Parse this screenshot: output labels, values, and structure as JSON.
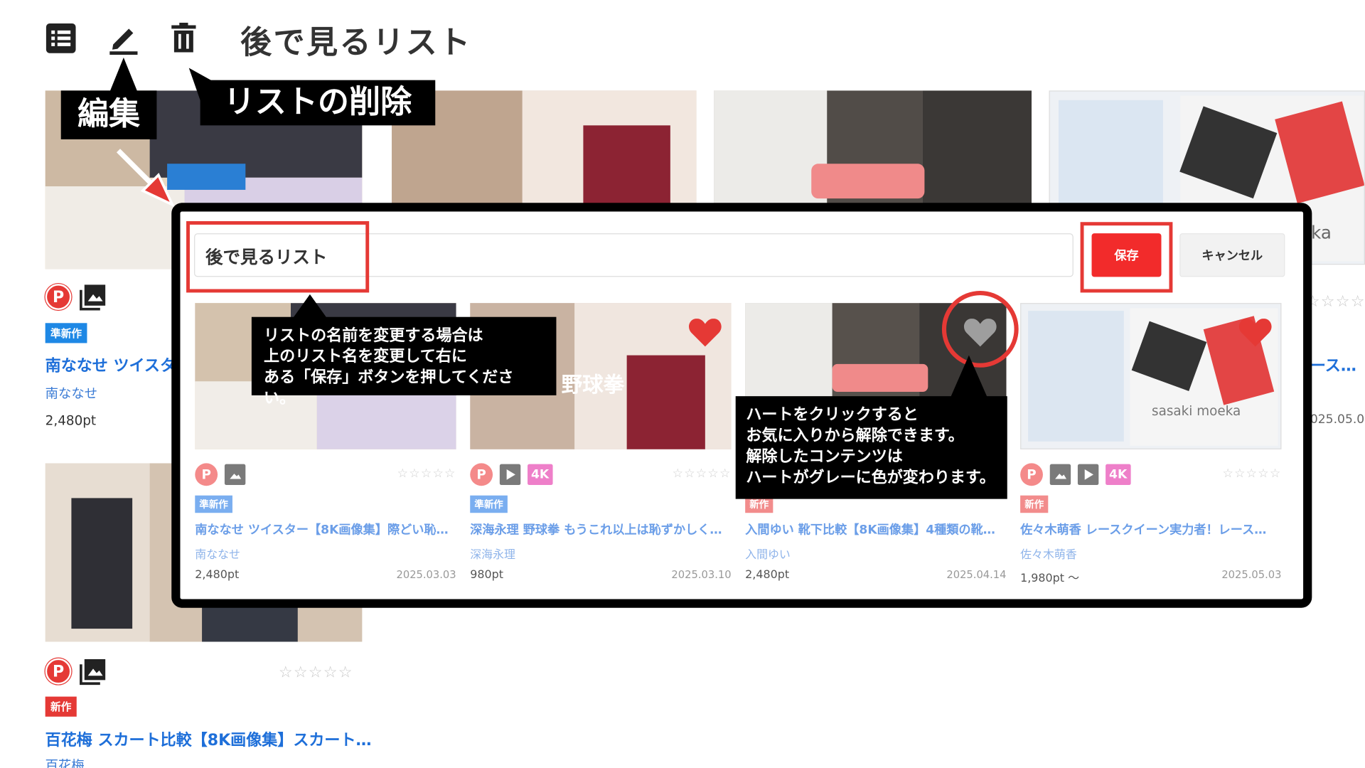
{
  "page": {
    "title": "後で見るリスト"
  },
  "toolbar": {
    "list_icon": "list-icon",
    "edit_icon": "pencil-icon",
    "delete_icon": "trash-icon"
  },
  "callouts": {
    "edit": "編集",
    "delete": "リストの削除",
    "rename_lines": [
      "リストの名前を変更する場合は",
      "上のリスト名を変更して右に",
      "ある「保存」ボタンを押してください。"
    ],
    "heart_lines": [
      "ハートをクリックすると",
      "お気に入りから解除できます。",
      "解除したコンテンツは",
      "ハートがグレーに色が変わります。"
    ]
  },
  "background_cards": [
    {
      "badge": "P",
      "tag": "準新作",
      "title": "南ななせ ツイスター",
      "author": "南ななせ",
      "price": "2,480pt"
    },
    {
      "badge": "P",
      "tag": "新作",
      "title": "百花梅 スカート比較【8K画像集】スカート…",
      "author": "百花梅",
      "price": ""
    }
  ],
  "background_right": {
    "title_fragment": "ース…",
    "date_fragment": "025.05.03",
    "overlay_text": "ka"
  },
  "modal": {
    "list_name_value": "後で見るリスト",
    "save_label": "保存",
    "cancel_label": "キャンセル",
    "cards": [
      {
        "tag": "準新作",
        "tag_color": "blue",
        "title": "南ななせ ツイスター【8K画像集】際どい恥…",
        "author": "南ななせ",
        "price": "2,480pt",
        "date": "2025.03.03",
        "icons": [
          "gallery"
        ],
        "has_4k": false,
        "heart": "red"
      },
      {
        "tag": "準新作",
        "tag_color": "blue",
        "title": "深海永理 野球拳 もうこれ以上は恥ずかしく…",
        "author": "深海永理",
        "price": "980pt",
        "date": "2025.03.10",
        "icons": [
          "video"
        ],
        "has_4k": true,
        "heart": "red",
        "thumb_text": "野球拳"
      },
      {
        "tag": "新作",
        "tag_color": "red",
        "title": "入間ゆい 靴下比較【8K画像集】4種類の靴…",
        "author": "入間ゆい",
        "price": "2,480pt",
        "date": "2025.04.14",
        "icons": [
          "gallery"
        ],
        "has_4k": false,
        "heart": "grey"
      },
      {
        "tag": "新作",
        "tag_color": "red",
        "title": "佐々木萌香 レースクイーン実力者！レース…",
        "author": "佐々木萌香",
        "price": "1,980pt 〜",
        "date": "2025.05.03",
        "icons": [
          "gallery",
          "video"
        ],
        "has_4k": true,
        "heart": "red",
        "thumb_text": "sasaki moeka"
      }
    ],
    "p_badge": "P",
    "label_4k": "4K"
  },
  "colors": {
    "accent_red": "#f22b2b",
    "link_blue": "#1e6fd9",
    "tag_blue": "#1e88e5",
    "heart_red": "#e53935",
    "heart_grey": "#9e9e9e"
  }
}
